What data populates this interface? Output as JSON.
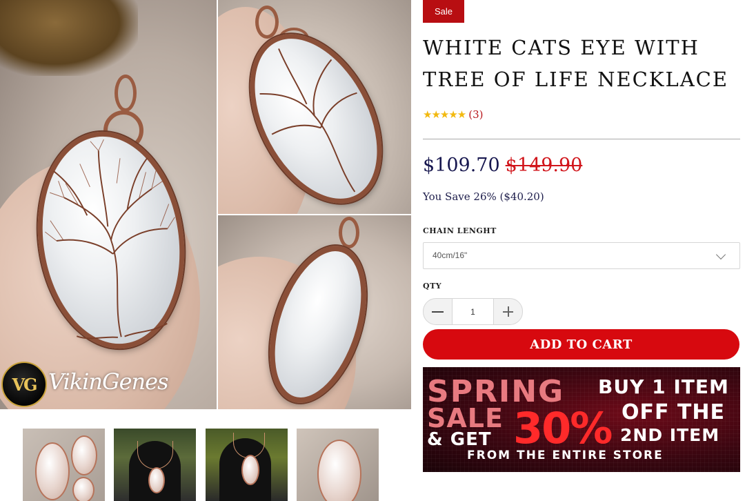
{
  "gallery": {
    "logo": {
      "monogram": "VG",
      "brand": "VikinGenes"
    },
    "thumbnail_count": 4
  },
  "product": {
    "badge": "Sale",
    "title": "WHITE CATS EYE WITH TREE OF LIFE NECKLACE",
    "rating": {
      "stars": "★★★★★",
      "value": 5,
      "count_label": "(3)"
    },
    "price_current": "$109.70",
    "price_original": "$149.90",
    "savings": "You Save 26% ($40.20)"
  },
  "options": {
    "chain_label": "CHAIN LENGHT",
    "chain_selected": "40cm/16\"",
    "qty_label": "QTY",
    "qty_value": "1"
  },
  "actions": {
    "add_to_cart": "ADD TO CART"
  },
  "promo": {
    "line_spring": "SPRING",
    "line_buy": "BUY 1 ITEM",
    "line_sale": "SALE",
    "line_percent": "30%",
    "line_off": "OFF THE",
    "line_get": "& GET",
    "line_second": "2ND ITEM",
    "line_from": "FROM THE ENTIRE STORE"
  },
  "colors": {
    "accent_red": "#d7090f",
    "badge_red": "#b80e12",
    "price_navy": "#17174f",
    "star_gold": "#f2b90f"
  }
}
